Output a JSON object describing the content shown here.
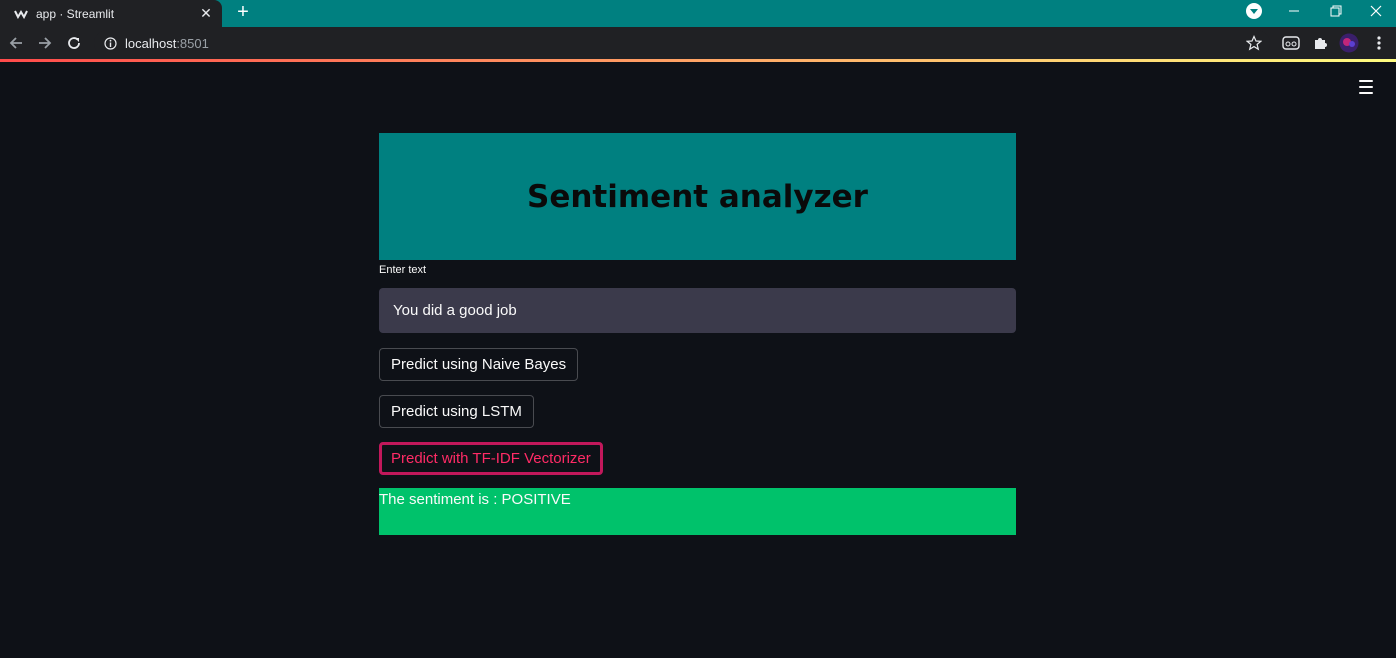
{
  "browser": {
    "tab_title": "app · Streamlit",
    "url_host": "localhost",
    "url_port": ":8501",
    "new_tab_symbol": "+",
    "icons": [
      "streamlit-favicon",
      "close-icon",
      "plus-icon",
      "back-icon",
      "forward-icon",
      "reload-icon",
      "info-icon",
      "star-icon",
      "extension-icon",
      "puzzle-icon",
      "avatar",
      "menu-dots-icon",
      "minimize-icon",
      "restore-icon",
      "window-close-icon"
    ]
  },
  "app": {
    "title": "Sentiment analyzer",
    "input_label": "Enter text",
    "input_value": "You did a good job",
    "buttons": {
      "naive_bayes": "Predict using Naive Bayes",
      "lstm": "Predict using LSTM",
      "tfidf": "Predict with TF-IDF Vectorizer"
    },
    "result": "The sentiment is : POSITIVE"
  },
  "colors": {
    "background": "#0e1117",
    "header": "#008080",
    "input_bg": "#3b3a4b",
    "result_bg": "#00c26b",
    "active_border": "#c2185b",
    "active_text": "#ff2b66"
  }
}
